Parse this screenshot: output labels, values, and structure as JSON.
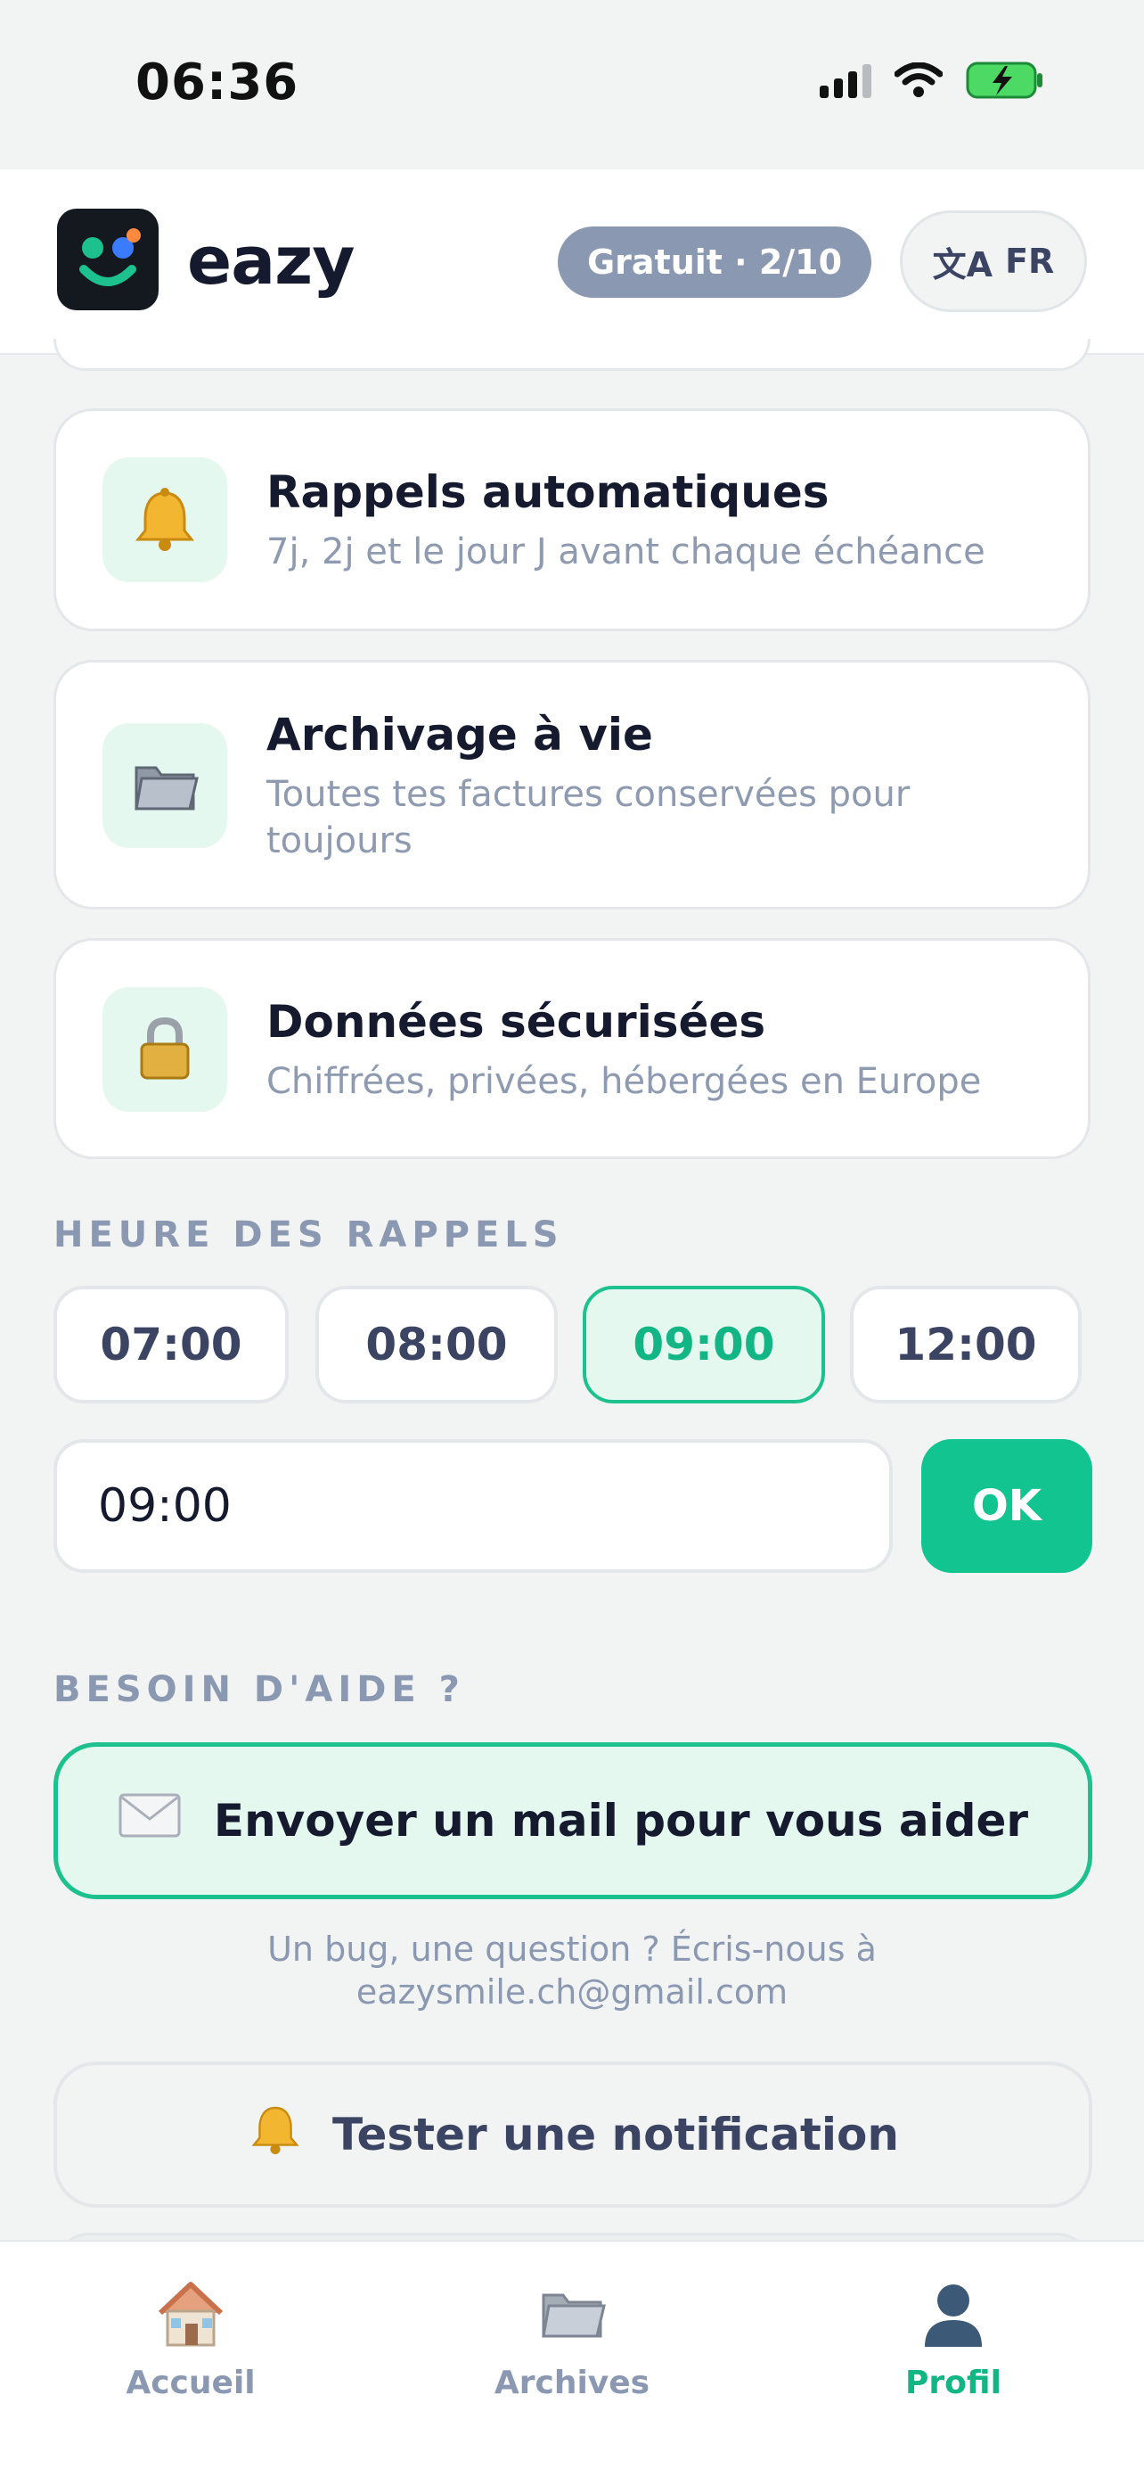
{
  "status_bar": {
    "time": "06:36"
  },
  "header": {
    "app_name": "eazy",
    "plan_badge": "Gratuit · 2/10",
    "language_icon": "文A",
    "language": "FR"
  },
  "features": [
    {
      "icon": "bell-icon",
      "title": "Rappels automatiques",
      "subtitle": "7j, 2j et le jour J avant chaque échéance"
    },
    {
      "icon": "folder-icon",
      "title": "Archivage à vie",
      "subtitle": "Toutes tes factures conservées pour toujours"
    },
    {
      "icon": "lock-icon",
      "title": "Données sécurisées",
      "subtitle": "Chiffrées, privées, hébergées en Europe"
    }
  ],
  "reminder_time": {
    "section_label": "HEURE DES RAPPELS",
    "options": [
      "07:00",
      "08:00",
      "09:00",
      "12:00"
    ],
    "selected": "09:00",
    "input_value": "09:00",
    "ok_label": "OK"
  },
  "help": {
    "section_label": "BESOIN D'AIDE ?",
    "mail_button_label": "Envoyer un mail pour vous aider",
    "help_text_line1": "Un bug, une question ? Écris-nous à",
    "help_text_line2": "eazysmile.ch@gmail.com",
    "test_notification_label": "Tester une notification"
  },
  "tab_bar": {
    "tabs": [
      {
        "label": "Accueil",
        "icon": "house-icon"
      },
      {
        "label": "Archives",
        "icon": "folder-icon"
      },
      {
        "label": "Profil",
        "icon": "person-icon"
      }
    ],
    "active": "Profil"
  },
  "colors": {
    "accent": "#12c48f",
    "accent_light": "#e4f8f0",
    "muted": "#8b98b2",
    "text": "#151a2e"
  }
}
